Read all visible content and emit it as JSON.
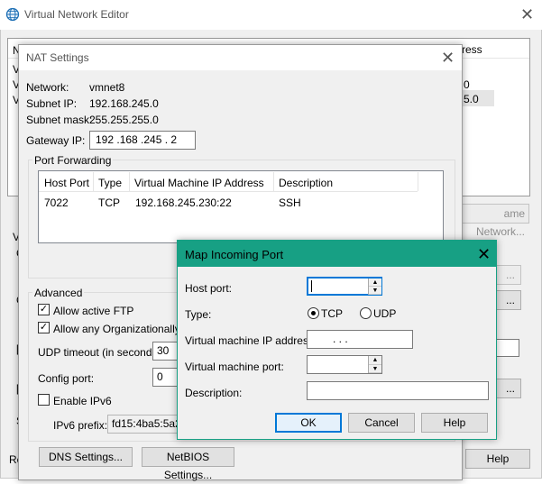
{
  "vne": {
    "title": "Virtual Network Editor",
    "col_frag": "ress",
    "row_frag_1": "0",
    "row_frag_2": "5.0",
    "left_frag": [
      "N",
      "V",
      "V",
      "V"
    ],
    "rename_label": "ame Network...",
    "mid_left": [
      "V",
      "C",
      "C",
      "[",
      "[",
      "S"
    ],
    "btn_dots": "...",
    "btn_blank": "",
    "bottom_left": "Re",
    "help_label": "Help"
  },
  "nat": {
    "title": "NAT Settings",
    "network_label": "Network:",
    "network_value": "vmnet8",
    "subnet_ip_label": "Subnet IP:",
    "subnet_ip_value": "192.168.245.0",
    "subnet_mask_label": "Subnet mask:",
    "subnet_mask_value": "255.255.255.0",
    "gateway_label": "Gateway IP:",
    "gateway_value": "192 .168 .245 .  2",
    "port_forwarding_label": "Port Forwarding",
    "table_headers": [
      "Host Port",
      "Type",
      "Virtual Machine IP Address",
      "Description"
    ],
    "table_rows": [
      {
        "host_port": "7022",
        "type": "TCP",
        "vm_ip": "192.168.245.230:22",
        "description": "SSH"
      }
    ],
    "advanced_label": "Advanced",
    "allow_ftp": "Allow active FTP",
    "allow_org": "Allow any Organizationally Ur",
    "udp_timeout_label": "UDP timeout (in seconds):",
    "udp_timeout_value": "30",
    "config_port_label": "Config port:",
    "config_port_value": "0",
    "enable_ipv6": "Enable IPv6",
    "ipv6_prefix_label": "IPv6 prefix:",
    "ipv6_prefix_value": "fd15:4ba5:5a2",
    "dns_button": "DNS Settings...",
    "netbios_button": "NetBIOS Settings..."
  },
  "map": {
    "title": "Map Incoming Port",
    "host_port_label": "Host port:",
    "host_port_value": "",
    "type_label": "Type:",
    "tcp_label": "TCP",
    "udp_label": "UDP",
    "vm_ip_label": "Virtual machine IP address:",
    "vm_ip_value": ".       .       .",
    "vm_port_label": "Virtual machine port:",
    "vm_port_value": "",
    "description_label": "Description:",
    "description_value": "",
    "ok_button": "OK",
    "cancel_button": "Cancel",
    "help_button": "Help"
  },
  "colors": {
    "accent": "#0078d7",
    "dialog_header": "#17a084",
    "window_bg": "#f0f0f0"
  },
  "icons": {
    "app": "globe-icon",
    "close": "close-icon",
    "check": "check-icon"
  }
}
